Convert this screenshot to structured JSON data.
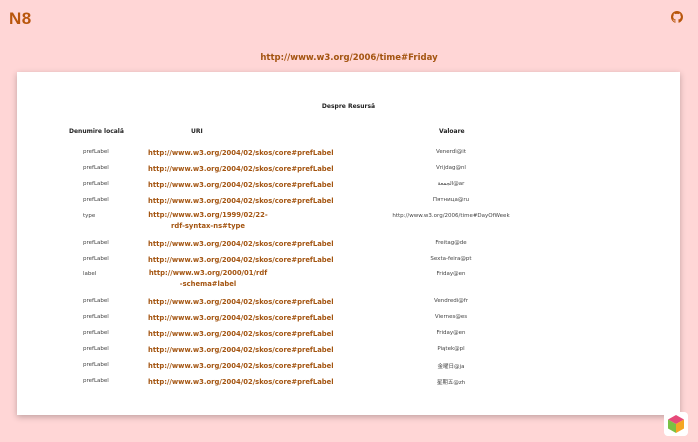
{
  "app": {
    "logo": "N8"
  },
  "page": {
    "uri": "http://www.w3.org/2006/time#Friday"
  },
  "card": {
    "title": "Despre Resursă",
    "headers": {
      "label": "Denumire locală",
      "uri": "URI",
      "value": "Valoare"
    },
    "rows": [
      {
        "label": "prefLabel",
        "uri": "http://www.w3.org/2004/02/skos/core#prefLabel",
        "value": "Venerdì@it"
      },
      {
        "label": "prefLabel",
        "uri": "http://www.w3.org/2004/02/skos/core#prefLabel",
        "value": "Vrijdag@nl"
      },
      {
        "label": "prefLabel",
        "uri": "http://www.w3.org/2004/02/skos/core#prefLabel",
        "value": "الجمعة@ar"
      },
      {
        "label": "prefLabel",
        "uri": "http://www.w3.org/2004/02/skos/core#prefLabel",
        "value": "Пятница@ru"
      },
      {
        "label": "type",
        "uri": "http://www.w3.org/1999/02/22-rdf-syntax-ns#type",
        "value": "http://www.w3.org/2006/time#DayOfWeek"
      },
      {
        "label": "prefLabel",
        "uri": "http://www.w3.org/2004/02/skos/core#prefLabel",
        "value": "Freitag@de"
      },
      {
        "label": "prefLabel",
        "uri": "http://www.w3.org/2004/02/skos/core#prefLabel",
        "value": "Sexta-feira@pt"
      },
      {
        "label": "label",
        "uri": "http://www.w3.org/2000/01/rdf-schema#label",
        "value": "Friday@en"
      },
      {
        "label": "prefLabel",
        "uri": "http://www.w3.org/2004/02/skos/core#prefLabel",
        "value": "Vendredi@fr"
      },
      {
        "label": "prefLabel",
        "uri": "http://www.w3.org/2004/02/skos/core#prefLabel",
        "value": "Viernes@es"
      },
      {
        "label": "prefLabel",
        "uri": "http://www.w3.org/2004/02/skos/core#prefLabel",
        "value": "Friday@en"
      },
      {
        "label": "prefLabel",
        "uri": "http://www.w3.org/2004/02/skos/core#prefLabel",
        "value": "Piątek@pl"
      },
      {
        "label": "prefLabel",
        "uri": "http://www.w3.org/2004/02/skos/core#prefLabel",
        "value": "金曜日@ja"
      },
      {
        "label": "prefLabel",
        "uri": "http://www.w3.org/2004/02/skos/core#prefLabel",
        "value": "星期五@zh"
      }
    ]
  },
  "icons": {
    "top_right": "github-icon",
    "corner": "cube-icon"
  },
  "colors": {
    "background": "#ffd6d6",
    "accent": "#a35410",
    "logo": "#b8560c"
  }
}
